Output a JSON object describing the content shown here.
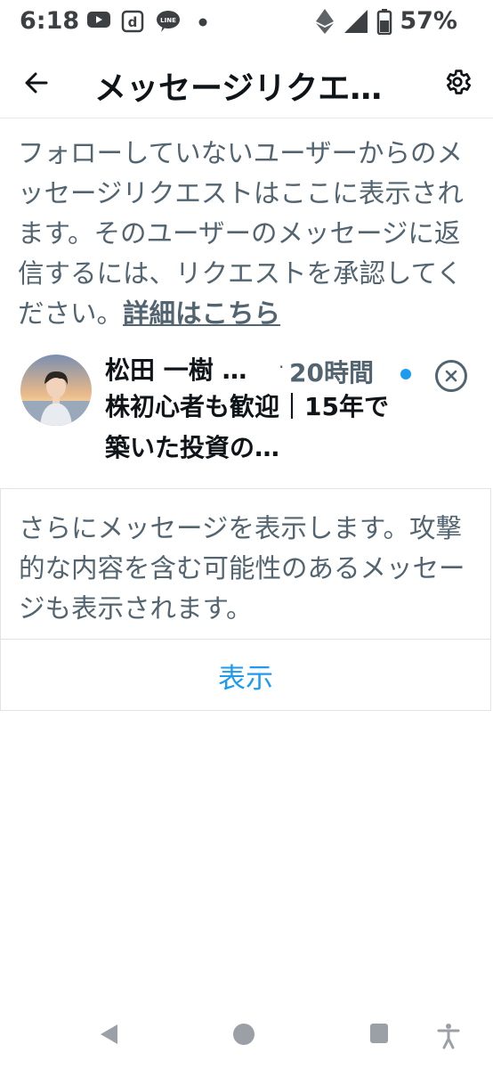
{
  "status_bar": {
    "time": "6:18",
    "battery_percent": "57%",
    "icons": [
      "youtube-icon",
      "d-app-icon",
      "line-icon",
      "notification-dot-icon",
      "ethereum-icon",
      "signal-icon",
      "battery-icon"
    ]
  },
  "header": {
    "title": "メッセージリクエ…",
    "back_icon": "arrow-left-icon",
    "settings_icon": "gear-icon"
  },
  "description": {
    "text": "フォローしていないユーザーからのメッセージリクエストはここに表示されます。そのユーザーのメッセージに返信するには、リクエストを承認してください。",
    "link": "詳細はこちら"
  },
  "requests": [
    {
      "name": "松田 一樹 …",
      "separator": "·",
      "time": "20時間",
      "preview": "株初心者も歓迎｜15年で築いた投資の…",
      "unread": true
    }
  ],
  "more": {
    "text": "さらにメッセージを表示します。攻撃的な内容を含む可能性のあるメッセージも表示されます。",
    "button": "表示"
  },
  "colors": {
    "accent": "#1d9bf0",
    "secondary_text": "#536471",
    "primary_text": "#0f1419",
    "border": "#e0e4e8"
  }
}
